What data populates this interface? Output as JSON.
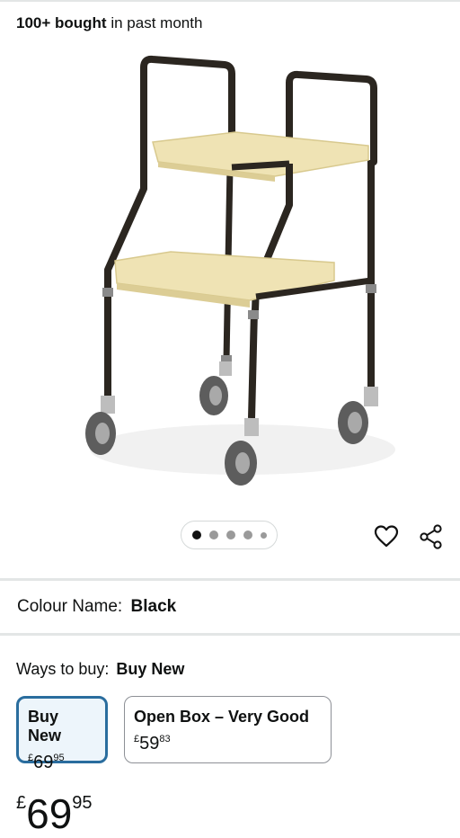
{
  "purchase_stats": {
    "bold": "100+ bought",
    "rest": "in past month"
  },
  "image_carousel": {
    "total": 5,
    "active_index": 0
  },
  "actions": {
    "wishlist_icon": "heart-icon",
    "share_icon": "share-icon"
  },
  "colour": {
    "label": "Colour Name:",
    "value": "Black"
  },
  "ways_to_buy": {
    "label": "Ways to buy:",
    "selected": "Buy New",
    "options": [
      {
        "label": "Buy New",
        "currency": "£",
        "whole": "69",
        "fraction": "95"
      },
      {
        "label": "Open Box – Very Good",
        "currency": "£",
        "whole": "59",
        "fraction": "83"
      }
    ]
  },
  "price": {
    "currency": "£",
    "whole": "69",
    "fraction": "95"
  },
  "colors": {
    "accent": "#2a6d9e",
    "selected_bg": "#edf5fb",
    "separator": "#e3e6e6"
  }
}
